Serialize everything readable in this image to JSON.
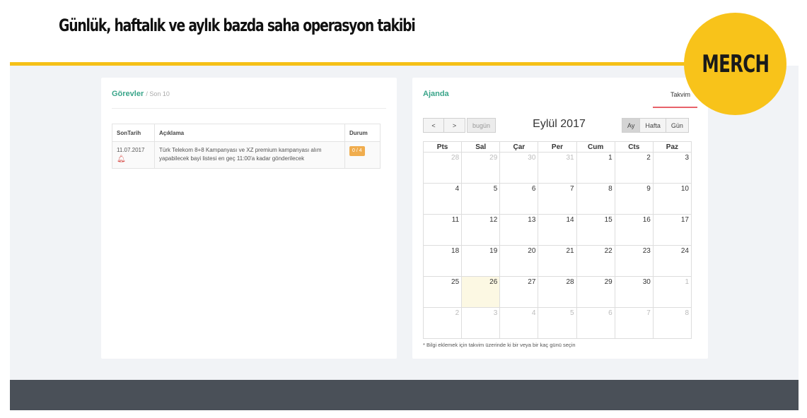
{
  "headline": "Günlük, haftalık ve aylık bazda saha operasyon takibi",
  "badge": "MERCH",
  "tasks": {
    "title": "Görevler",
    "subtitle": "/ Son 10",
    "columns": [
      "SonTarih",
      "Açıklama",
      "Durum"
    ],
    "rows": [
      {
        "date": "11.07.2017",
        "description": "Türk Telekom 8+8 Kampanyası ve XZ premium kampanyası alım yapabilecek bayi listesi en geç 11:00'a kadar gönderilecek",
        "status": "0 / 4"
      }
    ]
  },
  "agenda": {
    "title": "Ajanda",
    "tab": "Takvim",
    "nav_prev": "<",
    "nav_next": ">",
    "today_button": "bugün",
    "month_title": "Eylül 2017",
    "views": [
      "Ay",
      "Hafta",
      "Gün"
    ],
    "active_view": "Ay",
    "weekdays": [
      "Pts",
      "Sal",
      "Çar",
      "Per",
      "Cum",
      "Cts",
      "Paz"
    ],
    "weeks": [
      [
        {
          "d": "28",
          "o": true
        },
        {
          "d": "29",
          "o": true
        },
        {
          "d": "30",
          "o": true
        },
        {
          "d": "31",
          "o": true
        },
        {
          "d": "1"
        },
        {
          "d": "2"
        },
        {
          "d": "3"
        }
      ],
      [
        {
          "d": "4"
        },
        {
          "d": "5"
        },
        {
          "d": "6"
        },
        {
          "d": "7"
        },
        {
          "d": "8"
        },
        {
          "d": "9"
        },
        {
          "d": "10"
        }
      ],
      [
        {
          "d": "11"
        },
        {
          "d": "12"
        },
        {
          "d": "13"
        },
        {
          "d": "14"
        },
        {
          "d": "15"
        },
        {
          "d": "16"
        },
        {
          "d": "17"
        }
      ],
      [
        {
          "d": "18"
        },
        {
          "d": "19"
        },
        {
          "d": "20"
        },
        {
          "d": "21"
        },
        {
          "d": "22"
        },
        {
          "d": "23"
        },
        {
          "d": "24"
        }
      ],
      [
        {
          "d": "25"
        },
        {
          "d": "26",
          "t": true
        },
        {
          "d": "27"
        },
        {
          "d": "28"
        },
        {
          "d": "29"
        },
        {
          "d": "30"
        },
        {
          "d": "1",
          "o": true
        }
      ],
      [
        {
          "d": "2",
          "o": true
        },
        {
          "d": "3",
          "o": true
        },
        {
          "d": "4",
          "o": true
        },
        {
          "d": "5",
          "o": true
        },
        {
          "d": "6",
          "o": true
        },
        {
          "d": "7",
          "o": true
        },
        {
          "d": "8",
          "o": true
        }
      ]
    ],
    "note": "* Bilgi eklemek için takvim üzerinde ki bir veya bir kaç günü seçin"
  },
  "colors": {
    "accent_yellow": "#f5c018",
    "title_green": "#3aa58a",
    "tab_underline": "#e8626a",
    "footer": "#4a5058"
  }
}
